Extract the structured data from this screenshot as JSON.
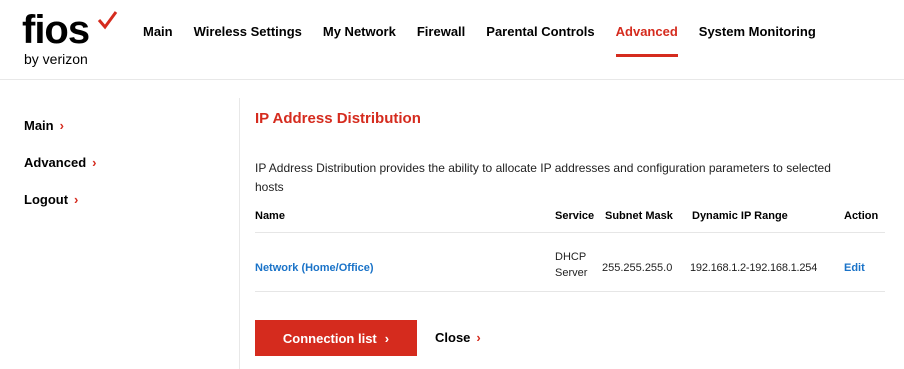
{
  "brand": {
    "name": "fios",
    "tagline": "by verizon",
    "accent": "#d52b1e"
  },
  "topnav": {
    "items": [
      {
        "label": "Main"
      },
      {
        "label": "Wireless Settings"
      },
      {
        "label": "My Network"
      },
      {
        "label": "Firewall"
      },
      {
        "label": "Parental Controls"
      },
      {
        "label": "Advanced",
        "active": true
      },
      {
        "label": "System Monitoring"
      }
    ]
  },
  "sidebar": {
    "items": [
      {
        "label": "Main",
        "icon": "chevron-right-icon"
      },
      {
        "label": "Advanced",
        "icon": "chevron-right-icon"
      },
      {
        "label": "Logout",
        "icon": "chevron-right-icon"
      }
    ]
  },
  "main": {
    "title": "IP Address Distribution",
    "description": "IP Address Distribution provides the ability to allocate IP addresses and configuration parameters to selected hosts",
    "table": {
      "headers": [
        "Name",
        "Service",
        "Subnet Mask",
        "Dynamic IP Range",
        "Action"
      ],
      "rows": [
        {
          "name": "Network (Home/Office)",
          "service_line1": "DHCP",
          "service_line2": "Server",
          "subnet_mask": "255.255.255.0",
          "ip_range": "192.168.1.2-192.168.1.254",
          "action": "Edit"
        }
      ]
    },
    "connection_button": "Connection list",
    "close_link": "Close"
  },
  "glyphs": {
    "chevron": "›"
  }
}
